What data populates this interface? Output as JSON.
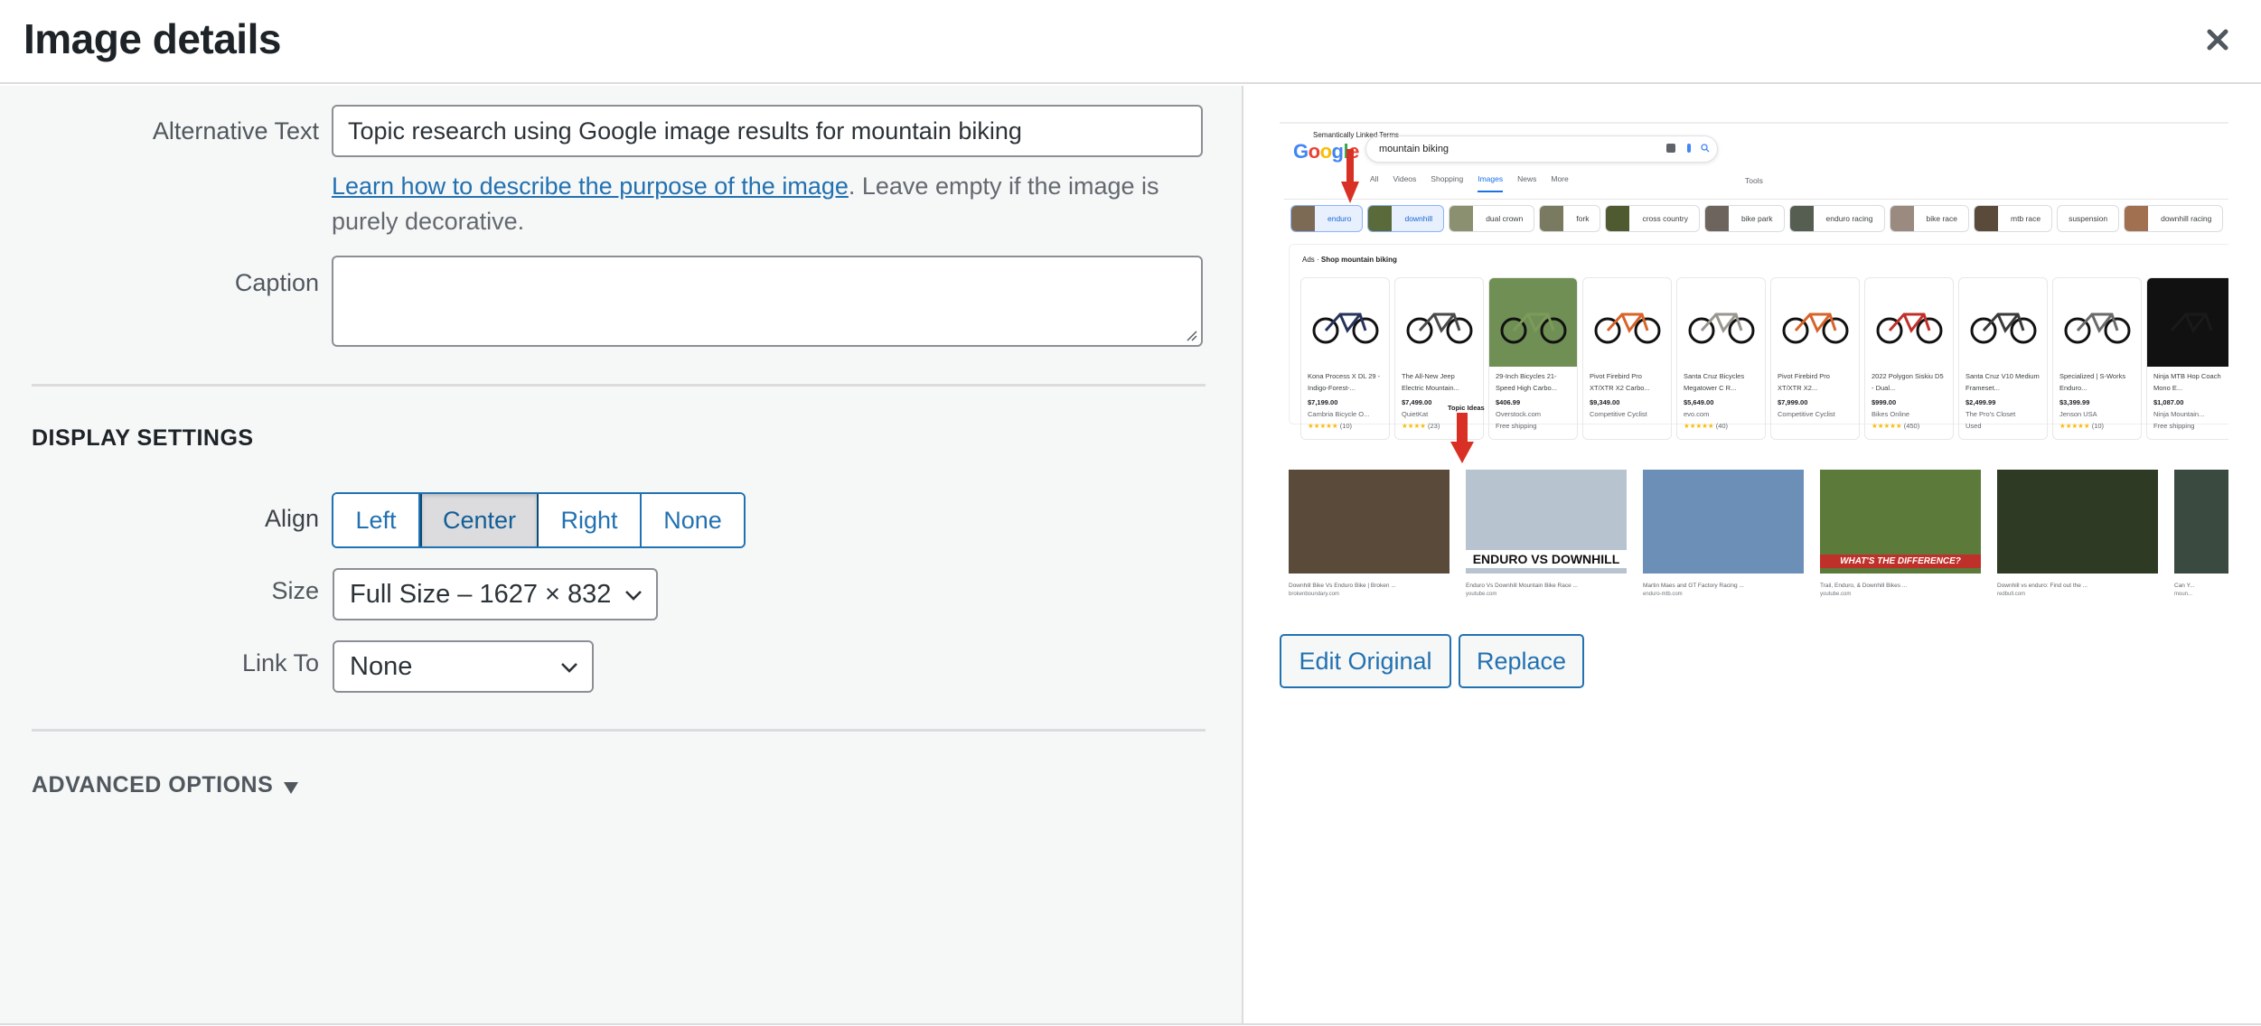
{
  "header": {
    "title": "Image details",
    "close_label": "Close"
  },
  "form": {
    "alt_text": {
      "label": "Alternative Text",
      "value": "Topic research using Google image results for mountain biking",
      "help_link": "Learn how to describe the purpose of the image",
      "help_rest": ". Leave empty if the image is purely decorative."
    },
    "caption": {
      "label": "Caption",
      "value": ""
    }
  },
  "display_settings": {
    "title": "DISPLAY SETTINGS",
    "align": {
      "label": "Align",
      "options": [
        "Left",
        "Center",
        "Right",
        "None"
      ],
      "selected": "Center"
    },
    "size": {
      "label": "Size",
      "value": "Full Size – 1627 × 832"
    },
    "link_to": {
      "label": "Link To",
      "value": "None"
    }
  },
  "advanced": {
    "label": "ADVANCED OPTIONS"
  },
  "preview": {
    "annotation_top": "Semantically Linked Terms",
    "annotation_mid": "Topic Ideas",
    "search_query": "mountain biking",
    "tabs": [
      "All",
      "Videos",
      "Shopping",
      "Images",
      "News",
      "More"
    ],
    "active_tab": "Images",
    "tools": "Tools",
    "chips": [
      "enduro",
      "downhill",
      "dual crown",
      "fork",
      "cross country",
      "bike park",
      "enduro racing",
      "bike race",
      "mtb race",
      "suspension",
      "downhill racing"
    ],
    "ads_prefix": "Ads",
    "ads_title": "Shop mountain biking",
    "products": [
      {
        "name": "Kona Process X DL 29 - Indigo-Forest-...",
        "price": "$7,199.00",
        "store": "Cambria Bicycle O...",
        "rating": "★★★★★",
        "reviews": "(10)"
      },
      {
        "name": "The All-New Jeep Electric Mountain...",
        "price": "$7,499.00",
        "store": "QuietKat",
        "rating": "★★★★",
        "reviews": "(23)"
      },
      {
        "name": "29-Inch Bicycles 21-Speed High Carbo...",
        "price": "$406.99",
        "store": "Overstock.com",
        "extra": "Free shipping"
      },
      {
        "name": "Pivot Firebird Pro XT/XTR X2 Carbo...",
        "price": "$9,349.00",
        "store": "Competitive Cyclist"
      },
      {
        "name": "Santa Cruz Bicycles Megatower C R...",
        "price": "$5,649.00",
        "store": "evo.com",
        "rating": "★★★★★",
        "reviews": "(40)"
      },
      {
        "name": "Pivot Firebird Pro XT/XTR X2...",
        "price": "$7,999.00",
        "store": "Competitive Cyclist"
      },
      {
        "name": "2022 Polygon Siskiu D5 - Dual...",
        "price": "$999.00",
        "store": "Bikes Online",
        "rating": "★★★★★",
        "reviews": "(450)"
      },
      {
        "name": "Santa Cruz V10 Medium Frameset...",
        "price": "$2,499.99",
        "store": "The Pro's Closet",
        "extra": "Used"
      },
      {
        "name": "Specialized | S-Works Enduro...",
        "price": "$3,399.99",
        "store": "Jenson USA",
        "rating": "★★★★★",
        "reviews": "(10)"
      },
      {
        "name": "Ninja MTB Hop Coach Mono E...",
        "price": "$1,087.00",
        "store": "Ninja Mountain...",
        "extra": "Free shipping"
      }
    ],
    "results": [
      {
        "title": "Downhill Bike Vs Enduro Bike | Broken ...",
        "source": "brokenboundary.com"
      },
      {
        "title": "Enduro Vs Downhill Mountain Bike Race ...",
        "source": "youtube.com",
        "overlay": "ENDURO VS DOWNHILL"
      },
      {
        "title": "Martin Maes and GT Factory Racing ...",
        "source": "enduro-mtb.com"
      },
      {
        "title": "Trail, Enduro, & Downhill Bikes ...",
        "source": "youtube.com",
        "overlay": "WHAT'S THE DIFFERENCE?"
      },
      {
        "title": "Downhill vs enduro: Find out the ...",
        "source": "redbull.com"
      },
      {
        "title": "Can Y...",
        "source": "moun..."
      }
    ]
  },
  "actions": {
    "edit_original": "Edit Original",
    "replace": "Replace"
  },
  "colors": {
    "accent": "#2271b1",
    "panel_bg": "#f6f7f7",
    "arrow_red": "#d93025"
  }
}
